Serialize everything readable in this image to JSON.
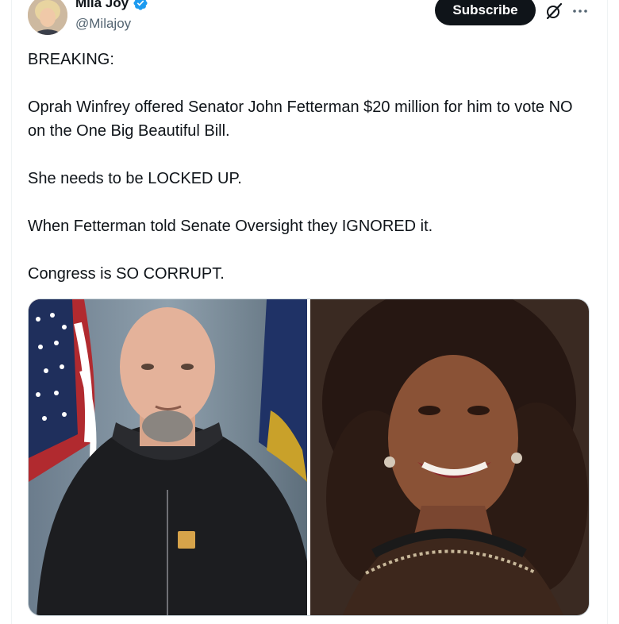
{
  "author": {
    "display_name": "Mila Joy",
    "handle": "@Milajoy",
    "verified_icon": "verified-badge-icon",
    "avatar_icon": "avatar-photo"
  },
  "actions": {
    "subscribe_label": "Subscribe",
    "grok_icon": "grok-icon",
    "more_icon": "more-options-icon"
  },
  "post": {
    "paragraphs": [
      "BREAKING:",
      "Oprah Winfrey offered Senator John Fetterman $20 million for him to vote NO on the One Big Beautiful Bill.",
      "She needs to be LOCKED UP.",
      "When Fetterman told Senate Oversight they IGNORED it.",
      "Congress is SO CORRUPT."
    ]
  },
  "media": {
    "images": [
      "photo-man-in-dark-hoodie-with-flags",
      "photo-smiling-woman-with-curly-hair"
    ]
  },
  "colors": {
    "accent_verified": "#1d9bf0",
    "button_bg": "#0f1419",
    "secondary_text": "#536471"
  }
}
